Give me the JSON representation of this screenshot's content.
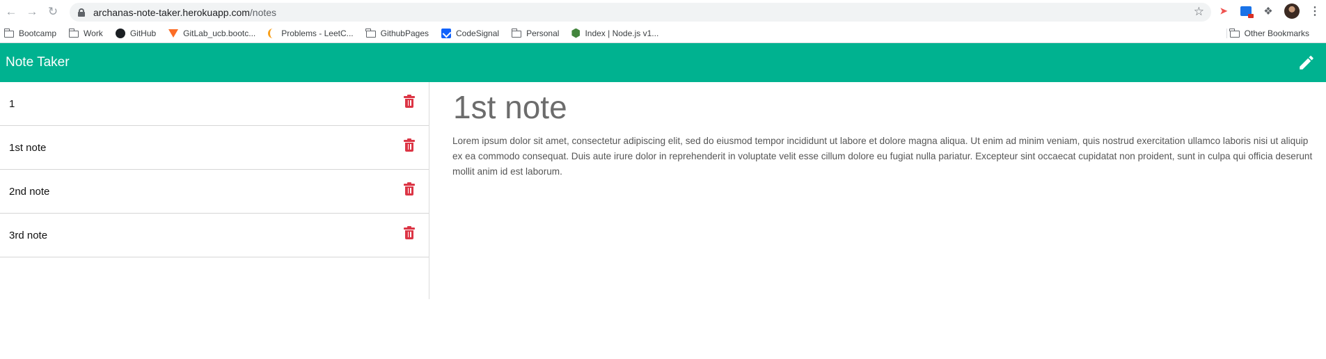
{
  "browser": {
    "url_host": "archanas-note-taker.herokuapp.com",
    "url_path": "/notes",
    "bookmarks": [
      {
        "label": "Bootcamp",
        "icon": "folder-icon"
      },
      {
        "label": "Work",
        "icon": "folder-icon"
      },
      {
        "label": "GitHub",
        "icon": "github-icon"
      },
      {
        "label": "GitLab_ucb.bootc...",
        "icon": "gitlab-icon"
      },
      {
        "label": "Problems - LeetC...",
        "icon": "leetcode-icon"
      },
      {
        "label": "GithubPages",
        "icon": "folder-icon"
      },
      {
        "label": "CodeSignal",
        "icon": "codesignal-icon"
      },
      {
        "label": "Personal",
        "icon": "folder-icon"
      },
      {
        "label": "Index | Node.js v1...",
        "icon": "nodejs-icon"
      }
    ],
    "other_bookmarks": "Other Bookmarks"
  },
  "app": {
    "brand": "Note Taker",
    "accent_color": "#00b290",
    "delete_color": "#dc3545"
  },
  "notes": {
    "items": [
      {
        "title": "1"
      },
      {
        "title": "1st note"
      },
      {
        "title": "2nd note"
      },
      {
        "title": "3rd note"
      }
    ]
  },
  "active_note": {
    "title": "1st note",
    "text": "Lorem ipsum dolor sit amet, consectetur adipiscing elit, sed do eiusmod tempor incididunt ut labore et dolore magna aliqua. Ut enim ad minim veniam, quis nostrud exercitation ullamco laboris nisi ut aliquip ex ea commodo consequat. Duis aute irure dolor in reprehenderit in voluptate velit esse cillum dolore eu fugiat nulla pariatur. Excepteur sint occaecat cupidatat non proident, sunt in culpa qui officia deserunt mollit anim id est laborum."
  }
}
